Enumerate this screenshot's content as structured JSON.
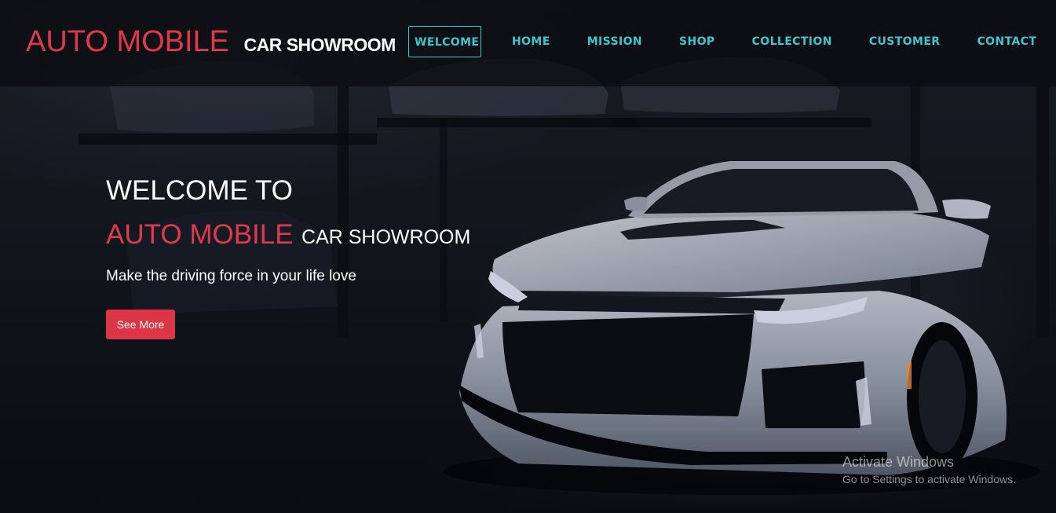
{
  "brand": {
    "main": "AUTO MOBILE",
    "sub": "CAR SHOWROOM"
  },
  "nav": {
    "items": [
      {
        "label": "WELCOME",
        "active": true
      },
      {
        "label": "HOME"
      },
      {
        "label": "MISSION"
      },
      {
        "label": "SHOP"
      },
      {
        "label": "COLLECTION"
      },
      {
        "label": "CUSTOMER"
      },
      {
        "label": "CONTACT"
      }
    ]
  },
  "hero": {
    "line1": "WELCOME TO",
    "brand": "AUTO MOBILE",
    "sub": "CAR SHOWROOM",
    "tagline": "Make the driving force in your life love",
    "button_label": "See More"
  },
  "watermark": {
    "title": "Activate Windows",
    "subtitle": "Go to Settings to activate Windows."
  },
  "colors": {
    "accent_red": "#dc3545",
    "brand_red": "#e0394b",
    "nav_teal": "#3cc6cf"
  }
}
